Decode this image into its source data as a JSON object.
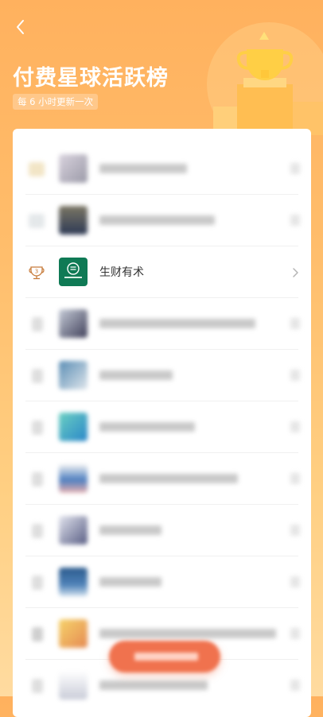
{
  "header": {
    "back_icon": "chevron-left-icon",
    "title": "付费星球活跃榜",
    "subtitle": "每 6 小时更新一次",
    "decor_icon": "trophy-icon"
  },
  "list": {
    "visible_row": {
      "rank": "3",
      "name": "生财有术",
      "avatar_icon": "coin-logo-icon",
      "avatar_color": "#0f7a55",
      "chevron_icon": "chevron-right-icon"
    }
  },
  "colors": {
    "brand": "#ffb15e",
    "accent_button": "#f0724e",
    "rank_badge": "#c77b3a"
  }
}
